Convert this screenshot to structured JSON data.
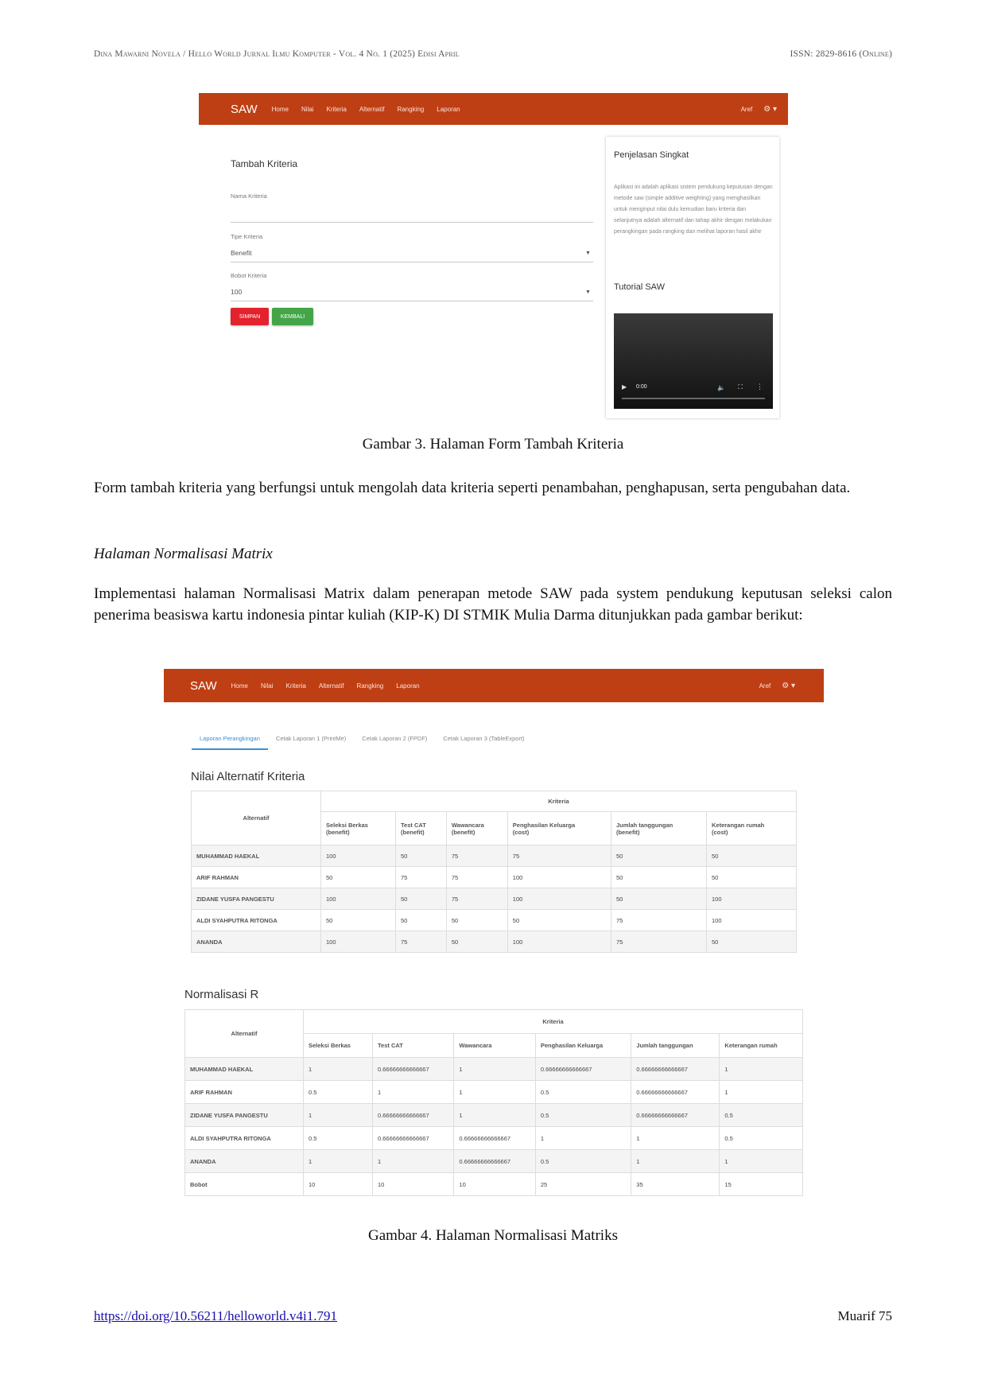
{
  "header": {
    "left": "Dina Mawarni Novela / Hello World Jurnal Ilmu Komputer - Vol. 4 No. 1 (2025) Edisi April",
    "right": "ISSN: 2829-8616 (Online)"
  },
  "nav": {
    "brand": "SAW",
    "items": [
      "Home",
      "Nilai",
      "Kriteria",
      "Alternatif",
      "Rangking",
      "Laporan"
    ],
    "user": "Aref"
  },
  "fig3": {
    "form_title": "Tambah Kriteria",
    "nama_label": "Nama Kriteria",
    "tipe_label": "Tipe Kriteria",
    "tipe_value": "Benefit",
    "bobot_label": "Bobot Kriteria",
    "bobot_value": "100",
    "btn_save": "SIMPAN",
    "btn_back": "KEMBALI",
    "side_title": "Penjelasan Singkat",
    "side_text": "Aplikasi ini adalah aplikasi sistem pendukung keputusan dengan metode saw (simple additive weighting) yang menghasilkan untuk menginput nilai dulu kemudian baru kriteria dan selanjutnya adalah alternatif dan tahap akhir dengan melakukan perangkingan pada rangking dan melihat laporan hasil akhir",
    "tutorial_title": "Tutorial SAW",
    "video_time": "0:00",
    "accent": "#bf3f14",
    "save_color": "#e2222d",
    "back_color": "#43a547"
  },
  "caption3": "Gambar 3. Halaman Form Tambah Kriteria",
  "para1": "Form tambah kriteria yang berfungsi untuk mengolah data kriteria seperti penambahan, penghapusan, serta pengubahan data.",
  "subheading": "Halaman Normalisasi Matrix",
  "para2": "Implementasi halaman Normalisasi Matrix dalam penerapan metode SAW pada system pendukung keputusan seleksi calon penerima beasiswa kartu indonesia pintar kuliah (KIP-K) DI STMIK Mulia Darma ditunjukkan pada gambar berikut:",
  "fig4": {
    "tabs": [
      "Laporan Perangkingan",
      "Cetak Laporan 1 (PrintMe)",
      "Cetak Laporan 2 (FPDF)",
      "Cetak Laporan 3 (TableExport)"
    ],
    "table1_title": "Nilai Alternatif Kriteria",
    "table1": {
      "alt_header": "Alternatif",
      "group_header": "Kriteria",
      "columns": [
        {
          "name": "Seleksi Berkas",
          "type": "(benefit)"
        },
        {
          "name": "Test CAT",
          "type": "(benefit)"
        },
        {
          "name": "Wawancara",
          "type": "(benefit)"
        },
        {
          "name": "Penghasilan Keluarga",
          "type": "(cost)"
        },
        {
          "name": "Jumlah tanggungan",
          "type": "(benefit)"
        },
        {
          "name": "Keterangan rumah",
          "type": "(cost)"
        }
      ],
      "rows": [
        {
          "name": "MUHAMMAD HAEKAL",
          "values": [
            "100",
            "50",
            "75",
            "75",
            "50",
            "50"
          ]
        },
        {
          "name": "ARIF RAHMAN",
          "values": [
            "50",
            "75",
            "75",
            "100",
            "50",
            "50"
          ]
        },
        {
          "name": "ZIDANE YUSFA PANGESTU",
          "values": [
            "100",
            "50",
            "75",
            "100",
            "50",
            "100"
          ]
        },
        {
          "name": "ALDI SYAHPUTRA RITONGA",
          "values": [
            "50",
            "50",
            "50",
            "50",
            "75",
            "100"
          ]
        },
        {
          "name": "ANANDA",
          "values": [
            "100",
            "75",
            "50",
            "100",
            "75",
            "50"
          ]
        }
      ]
    },
    "table2_title": "Normalisasi R",
    "table2": {
      "alt_header": "Alternatif",
      "group_header": "Kriteria",
      "columns": [
        "Seleksi Berkas",
        "Test CAT",
        "Wawancara",
        "Penghasilan Keluarga",
        "Jumlah tanggungan",
        "Keterangan rumah"
      ],
      "rows": [
        {
          "name": "MUHAMMAD HAEKAL",
          "values": [
            "1",
            "0.66666666666667",
            "1",
            "0.66666666666667",
            "0.66666666666667",
            "1"
          ]
        },
        {
          "name": "ARIF RAHMAN",
          "values": [
            "0.5",
            "1",
            "1",
            "0.5",
            "0.66666666666667",
            "1"
          ]
        },
        {
          "name": "ZIDANE YUSFA PANGESTU",
          "values": [
            "1",
            "0.66666666666667",
            "1",
            "0.5",
            "0.66666666666667",
            "0.5"
          ]
        },
        {
          "name": "ALDI SYAHPUTRA RITONGA",
          "values": [
            "0.5",
            "0.66666666666667",
            "0.66666666666667",
            "1",
            "1",
            "0.5"
          ]
        },
        {
          "name": "ANANDA",
          "values": [
            "1",
            "1",
            "0.66666666666667",
            "0.5",
            "1",
            "1"
          ]
        },
        {
          "name": "Bobot",
          "values": [
            "10",
            "10",
            "10",
            "25",
            "35",
            "15"
          ]
        }
      ]
    }
  },
  "caption4": "Gambar 4. Halaman Normalisasi Matriks",
  "footer": {
    "doi": "https://doi.org/10.56211/helloworld.v4i1.791",
    "author_page": "Muarif  75"
  }
}
